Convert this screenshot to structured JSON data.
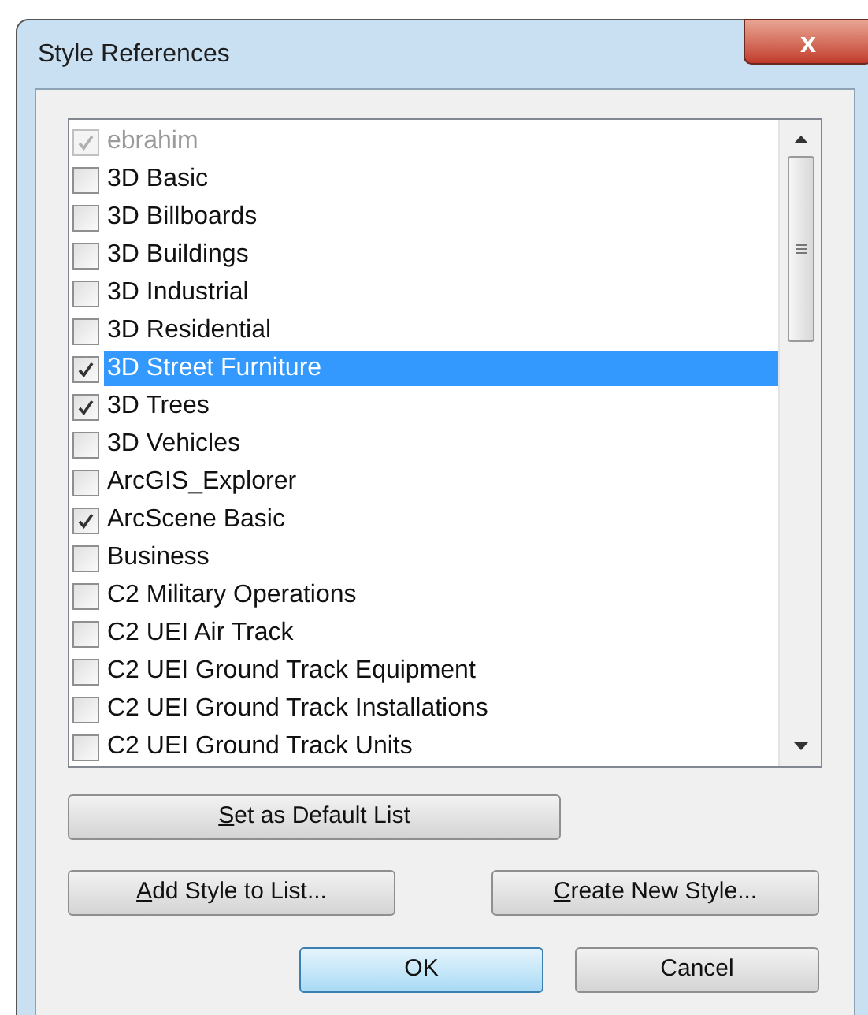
{
  "window": {
    "title": "Style References",
    "close": "x"
  },
  "styles": [
    {
      "label": "ebrahim",
      "checked": true,
      "disabled": true,
      "selected": false
    },
    {
      "label": "3D Basic",
      "checked": false,
      "disabled": false,
      "selected": false
    },
    {
      "label": "3D Billboards",
      "checked": false,
      "disabled": false,
      "selected": false
    },
    {
      "label": "3D Buildings",
      "checked": false,
      "disabled": false,
      "selected": false
    },
    {
      "label": "3D Industrial",
      "checked": false,
      "disabled": false,
      "selected": false
    },
    {
      "label": "3D Residential",
      "checked": false,
      "disabled": false,
      "selected": false
    },
    {
      "label": "3D Street Furniture",
      "checked": true,
      "disabled": false,
      "selected": true
    },
    {
      "label": "3D Trees",
      "checked": true,
      "disabled": false,
      "selected": false
    },
    {
      "label": "3D Vehicles",
      "checked": false,
      "disabled": false,
      "selected": false
    },
    {
      "label": "ArcGIS_Explorer",
      "checked": false,
      "disabled": false,
      "selected": false
    },
    {
      "label": "ArcScene Basic",
      "checked": true,
      "disabled": false,
      "selected": false
    },
    {
      "label": "Business",
      "checked": false,
      "disabled": false,
      "selected": false
    },
    {
      "label": "C2 Military Operations",
      "checked": false,
      "disabled": false,
      "selected": false
    },
    {
      "label": "C2 UEI Air Track",
      "checked": false,
      "disabled": false,
      "selected": false
    },
    {
      "label": "C2 UEI Ground Track Equipment",
      "checked": false,
      "disabled": false,
      "selected": false
    },
    {
      "label": "C2 UEI Ground Track Installations",
      "checked": false,
      "disabled": false,
      "selected": false
    },
    {
      "label": "C2 UEI Ground Track Units",
      "checked": false,
      "disabled": false,
      "selected": false
    }
  ],
  "buttons": {
    "set_default": {
      "label": "Set as Default List",
      "underline_first": true
    },
    "add_style": {
      "label": "Add Style to List...",
      "underline_first": true
    },
    "create_style": {
      "label": "Create New Style...",
      "underline_first": true
    },
    "ok": {
      "label": "OK",
      "underline_first": false,
      "focused": true
    },
    "cancel": {
      "label": "Cancel",
      "underline_first": false,
      "focused": false
    }
  }
}
